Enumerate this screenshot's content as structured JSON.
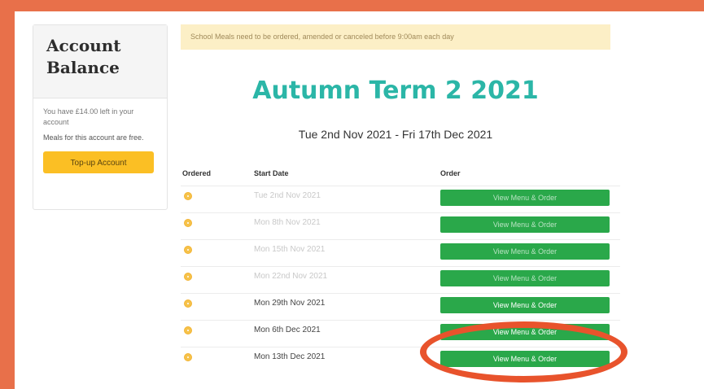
{
  "account": {
    "title": "Account Balance",
    "balance_text": "You have £14.00 left in your account",
    "free_text": "Meals for this account are free.",
    "topup_label": "Top-up Account"
  },
  "notice": "School Meals need to be ordered, amended or canceled before 9:00am each day",
  "term": {
    "title": "Autumn Term 2 2021",
    "dates": "Tue 2nd Nov 2021 - Fri 17th Dec 2021"
  },
  "table": {
    "headers": {
      "ordered": "Ordered",
      "start": "Start Date",
      "order": "Order"
    },
    "rows": [
      {
        "date": "Tue 2nd Nov 2021",
        "button": "View Menu & Order"
      },
      {
        "date": "Mon 8th Nov 2021",
        "button": "View Menu & Order"
      },
      {
        "date": "Mon 15th Nov 2021",
        "button": "View Menu & Order"
      },
      {
        "date": "Mon 22nd Nov 2021",
        "button": "View Menu & Order"
      },
      {
        "date": "Mon 29th Nov 2021",
        "button": "View Menu & Order"
      },
      {
        "date": "Mon 6th Dec 2021",
        "button": "View Menu & Order"
      },
      {
        "date": "Mon 13th Dec 2021",
        "button": "View Menu & Order"
      }
    ]
  },
  "colors": {
    "frame": "#e8704a",
    "accent_teal": "#2bb6a7",
    "order_green": "#2aa84a",
    "topup_yellow": "#fbbf24",
    "highlight_ring": "#e8532c"
  }
}
